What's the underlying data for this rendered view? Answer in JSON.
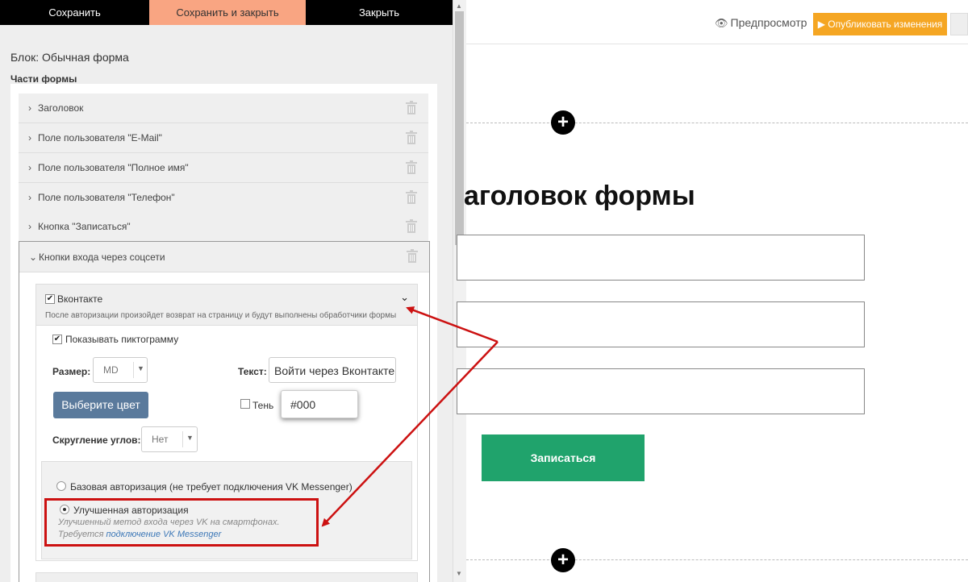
{
  "toolbar": {
    "save": "Сохранить",
    "save_close": "Сохранить и закрыть",
    "close": "Закрыть"
  },
  "panel": {
    "block_title": "Блок: Обычная форма",
    "parts_heading": "Части формы",
    "parts": [
      {
        "label": "Заголовок"
      },
      {
        "label": "Поле пользователя \"E-Mail\""
      },
      {
        "label": "Поле пользователя \"Полное имя\""
      },
      {
        "label": "Поле пользователя \"Телефон\""
      },
      {
        "label": "Кнопка \"Записаться\""
      }
    ],
    "social": {
      "label": "Кнопки входа через соцсети",
      "vk": {
        "label": "Вконтакте",
        "note": "После авторизации произойдет возврат на страницу и будут выполнены обработчики формы",
        "show_icon_label": "Показывать пиктограмму",
        "size_label": "Размер:",
        "size_value": "MD",
        "text_label": "Текст:",
        "text_value": "Войти через Вконтакте",
        "color_button": "Выберите цвет",
        "shadow_label": "Тень",
        "shadow_value": "#000",
        "rounding_label": "Скругление углов:",
        "rounding_value": "Нет",
        "auth_basic": "Базовая авторизация (не требует подключения VK Messenger)",
        "auth_advanced": "Улучшенная авторизация",
        "auth_advanced_desc": "Улучшенный метод входа через VK на смартфонах.",
        "auth_advanced_req": "Требуется ",
        "auth_advanced_link": "подключение VK Messenger"
      }
    }
  },
  "preview": {
    "preview_link": "Предпросмотр",
    "publish_button": "▶ Опубликовать изменения",
    "form_title": "аголовок формы",
    "submit_button": "Записаться"
  },
  "colors": {
    "save_close_bg": "#f9a582",
    "publish_bg": "#f5a623",
    "submit_bg": "#20a36c",
    "color_button_bg": "#5a7a9c",
    "annotation_red": "#cc1111"
  }
}
